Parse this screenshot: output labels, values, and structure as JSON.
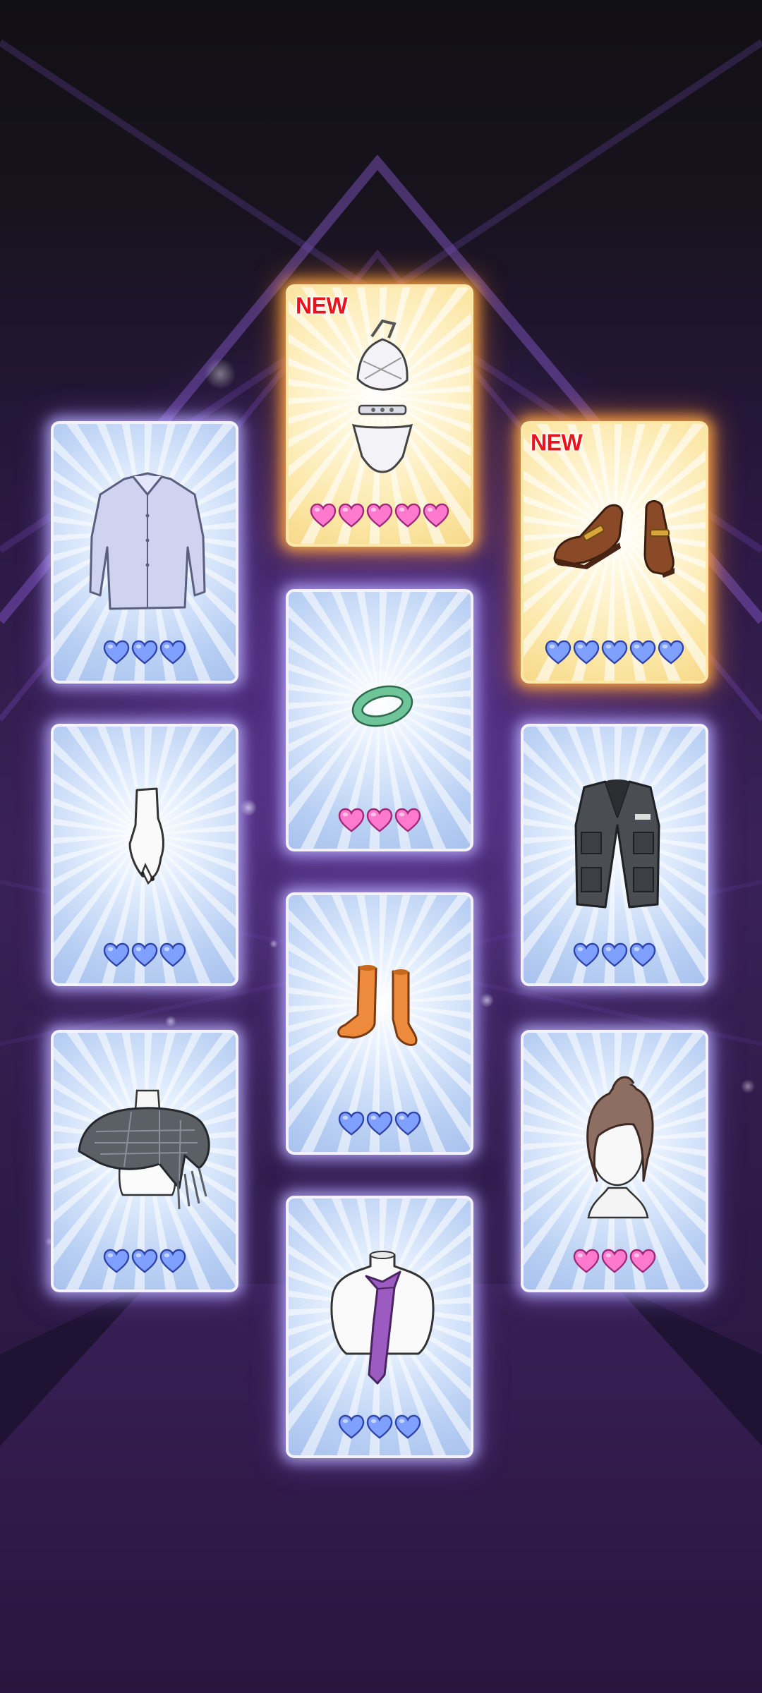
{
  "colors": {
    "heart_blue": "#7fa0ff",
    "heart_pink": "#ff79cf",
    "new_badge": "#e8141c",
    "card_blue": "#b8cff3",
    "card_gold": "#fbe6a4"
  },
  "cards": [
    {
      "item_icon": "shirt-icon",
      "rarity": "blue",
      "new": false,
      "hearts": 3,
      "heart_color": "blue"
    },
    {
      "item_icon": "swimsuit-icon",
      "rarity": "gold",
      "new": true,
      "badge": "NEW",
      "hearts": 5,
      "heart_color": "pink"
    },
    {
      "item_icon": "loafers-icon",
      "rarity": "gold",
      "new": true,
      "badge": "NEW",
      "hearts": 5,
      "heart_color": "blue"
    },
    {
      "item_icon": "bracelet-icon",
      "rarity": "blue",
      "new": false,
      "hearts": 3,
      "heart_color": "pink"
    },
    {
      "item_icon": "glove-icon",
      "rarity": "blue",
      "new": false,
      "hearts": 3,
      "heart_color": "blue"
    },
    {
      "item_icon": "vest-icon",
      "rarity": "blue",
      "new": false,
      "hearts": 3,
      "heart_color": "blue"
    },
    {
      "item_icon": "socks-icon",
      "rarity": "blue",
      "new": false,
      "hearts": 3,
      "heart_color": "blue"
    },
    {
      "item_icon": "scarf-icon",
      "rarity": "blue",
      "new": false,
      "hearts": 3,
      "heart_color": "blue"
    },
    {
      "item_icon": "hairstyle-icon",
      "rarity": "blue",
      "new": false,
      "hearts": 3,
      "heart_color": "pink"
    },
    {
      "item_icon": "necktie-icon",
      "rarity": "blue",
      "new": false,
      "hearts": 3,
      "heart_color": "blue"
    }
  ]
}
